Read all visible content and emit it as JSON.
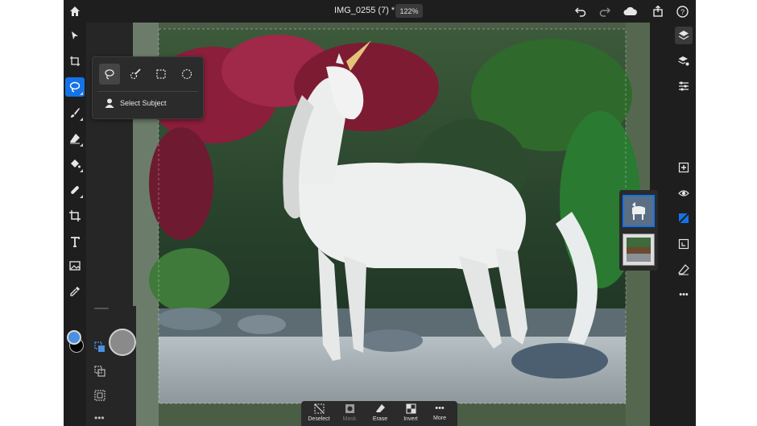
{
  "document": {
    "title": "IMG_0255 (7) *",
    "zoom": "122%"
  },
  "topbar": {
    "icons": [
      "home-icon",
      "undo-icon",
      "redo-icon",
      "cloud-icon",
      "share-icon",
      "help-icon"
    ]
  },
  "left_toolbar": {
    "tools": [
      "move-tool",
      "transform-tool",
      "lasso-select-tool",
      "brush-tool",
      "eraser-tool",
      "fill-tool",
      "healing-tool",
      "crop-tool",
      "type-tool",
      "place-image-tool",
      "eyedropper-tool"
    ],
    "active_tool": "lasso-select-tool",
    "foreground_color": "#4a90e2",
    "background_color": "#000000"
  },
  "selection_popover": {
    "options": [
      "lasso-option",
      "quick-select-option",
      "rectangle-marquee-option",
      "ellipse-marquee-option"
    ],
    "active_option": "lasso-option",
    "select_subject_label": "Select Subject"
  },
  "bottom_bar": {
    "deselect": "Deselect",
    "mask": "Mask",
    "erase": "Erase",
    "invert": "Invert",
    "more": "More"
  },
  "colors": {
    "accent": "#1473e6",
    "panel": "#1e1e1e"
  }
}
